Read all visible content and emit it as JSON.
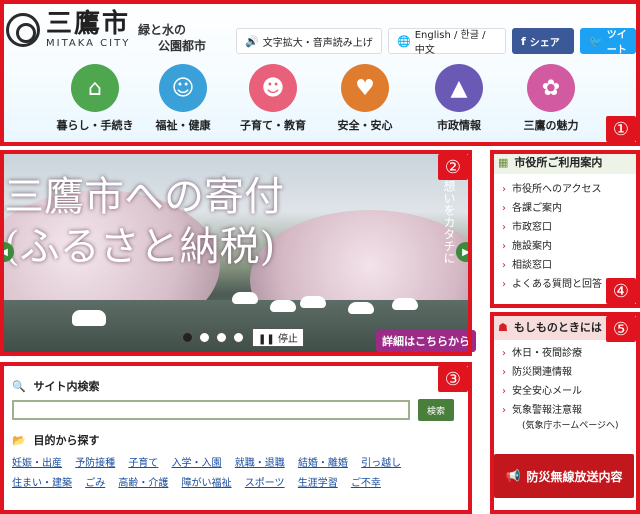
{
  "logo": {
    "jp": "三鷹市",
    "en": "MITAKA CITY"
  },
  "tagline": {
    "line1": "緑と水の",
    "line2": "公園都市"
  },
  "toolbar": {
    "accessibility": "文字拡大・音声読み上げ",
    "language": "English / 한글 / 中文",
    "facebook": "シェア",
    "twitter": "ツイート"
  },
  "nav": [
    {
      "label": "暮らし・手続き",
      "color": "#4ea64e",
      "icon": "house-icon"
    },
    {
      "label": "福祉・健康",
      "color": "#3aa0d8",
      "icon": "person-icon"
    },
    {
      "label": "子育て・教育",
      "color": "#e8607a",
      "icon": "baby-icon"
    },
    {
      "label": "安全・安心",
      "color": "#e07c2e",
      "icon": "heart-hands-icon"
    },
    {
      "label": "市政情報",
      "color": "#6a5ab5",
      "icon": "building-icon"
    },
    {
      "label": "三鷹の魅力",
      "color": "#d25aa0",
      "icon": "flower-icon"
    }
  ],
  "slider": {
    "title_line1": "三鷹市への寄付",
    "title_line2": "(ふるさと納税)",
    "vertical_text": "想いをカタチに",
    "stop_label": "停止",
    "detail_label": "詳細はこちらから"
  },
  "city_office": {
    "title": "市役所ご利用案内",
    "items": [
      "市役所へのアクセス",
      "各課ご案内",
      "市政窓口",
      "施設案内",
      "相談窓口",
      "よくある質問と回答"
    ]
  },
  "emergency": {
    "title": "もしものときには",
    "items": [
      "休日・夜間診療",
      "防災関連情報",
      "安全安心メール",
      "気象警報注意報"
    ],
    "note": "(気象庁ホームページへ)",
    "disaster_button": "防災無線放送内容"
  },
  "search": {
    "title": "サイト内検索",
    "placeholder": "",
    "button": "検索"
  },
  "purpose": {
    "title": "目的から探す",
    "links": [
      "妊娠・出産",
      "予防接種",
      "子育て",
      "入学・入園",
      "就職・退職",
      "結婚・離婚",
      "引っ越し",
      "住まい・建築",
      "ごみ",
      "高齢・介護",
      "障がい福祉",
      "スポーツ",
      "生涯学習",
      "ご不幸"
    ]
  },
  "badges": [
    "①",
    "②",
    "③",
    "④",
    "⑤"
  ]
}
